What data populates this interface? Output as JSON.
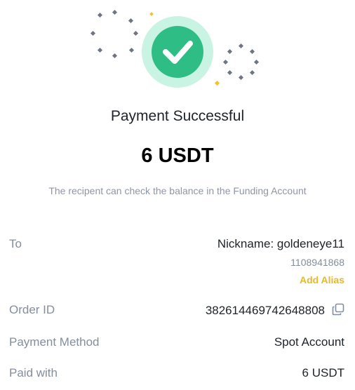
{
  "status": {
    "title": "Payment Successful",
    "amount": "6 USDT",
    "note": "The recipent can check the balance in the Funding Account",
    "icon": "check-circle-icon",
    "accent_color": "#2ebd85",
    "halo_color": "#c9f3e2"
  },
  "details": {
    "to": {
      "label": "To",
      "value": "Nickname: goldeneye11",
      "uid": "1108941868",
      "alias_link": "Add Alias"
    },
    "order": {
      "label": "Order ID",
      "value": "382614469742648808",
      "copy_icon": "copy-icon"
    },
    "method": {
      "label": "Payment Method",
      "value": "Spot Account"
    },
    "paid": {
      "label": "Paid with",
      "value": "6 USDT"
    }
  },
  "colors": {
    "link": "#e8b829",
    "muted": "#848e9c",
    "text": "#1e2329"
  }
}
